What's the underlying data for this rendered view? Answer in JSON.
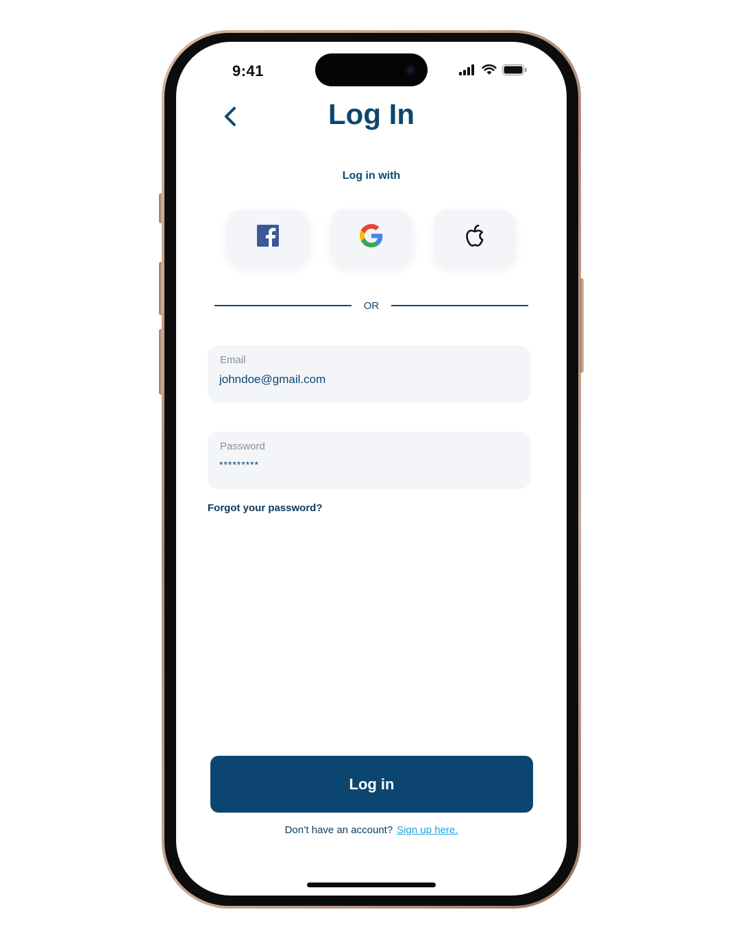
{
  "status_bar": {
    "time": "9:41",
    "icons": [
      "cellular-signal-icon",
      "wifi-icon",
      "battery-icon"
    ]
  },
  "header": {
    "title": "Log In",
    "back_icon": "chevron-left-icon"
  },
  "social": {
    "label": "Log in with",
    "providers": [
      {
        "name": "facebook",
        "icon": "facebook-icon"
      },
      {
        "name": "google",
        "icon": "google-icon"
      },
      {
        "name": "apple",
        "icon": "apple-icon"
      }
    ]
  },
  "divider": {
    "text": "OR"
  },
  "form": {
    "email": {
      "label": "Email",
      "value": "johndoe@gmail.com"
    },
    "password": {
      "label": "Password",
      "value": "*********"
    },
    "forgot_link": "Forgot your password?",
    "submit_label": "Log in"
  },
  "footer": {
    "prompt": "Don’t have an account?",
    "signup_link": "Sign up here."
  },
  "colors": {
    "primary": "#0c4670",
    "link": "#1aa3e0",
    "field_bg": "#f4f5f8",
    "frame": "#b08a74"
  }
}
